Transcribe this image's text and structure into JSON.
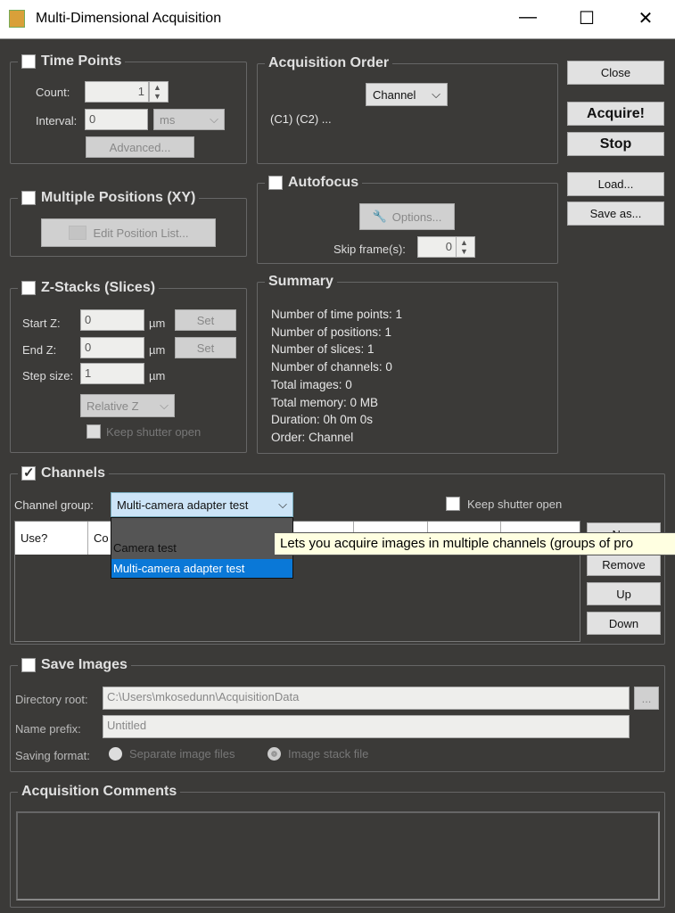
{
  "window": {
    "title": "Multi-Dimensional Acquisition",
    "minimize": "—",
    "maximize": "☐",
    "close": "✕"
  },
  "time_points": {
    "title": "Time Points",
    "checked": false,
    "count_label": "Count:",
    "count": "1",
    "interval_label": "Interval:",
    "interval": "0",
    "unit": "ms",
    "advanced": "Advanced..."
  },
  "positions": {
    "title": "Multiple Positions (XY)",
    "checked": false,
    "edit": "Edit Position List..."
  },
  "zstack": {
    "title": "Z-Stacks (Slices)",
    "checked": false,
    "start_label": "Start Z:",
    "start": "0",
    "end_label": "End Z:",
    "end": "0",
    "step_label": "Step size:",
    "step": "1",
    "unit": "µm",
    "set": "Set",
    "mode": "Relative Z",
    "keep_shutter": "Keep shutter open"
  },
  "order": {
    "title": "Acquisition Order",
    "mode": "Channel",
    "text": "(C1) (C2) ..."
  },
  "autofocus": {
    "title": "Autofocus",
    "checked": false,
    "options": "Options...",
    "skip_label": "Skip frame(s):",
    "skip": "0"
  },
  "summary": {
    "title": "Summary",
    "lines": [
      "Number of time points: 1",
      "Number of positions: 1",
      "Number of slices: 1",
      "Number of channels: 0",
      "Total images: 0",
      "Total memory: 0 MB",
      "Duration: 0h 0m 0s",
      "Order: Channel"
    ]
  },
  "buttons": {
    "close": "Close",
    "acquire": "Acquire!",
    "stop": "Stop",
    "load": "Load...",
    "save_as": "Save as..."
  },
  "channels": {
    "title": "Channels",
    "checked": true,
    "group_label": "Channel group:",
    "group": "Multi-camera adapter test",
    "keep_shutter": "Keep shutter open",
    "columns": [
      "Use?",
      "Co"
    ],
    "options": [
      "Camera test",
      "Multi-camera adapter test"
    ],
    "new": "New",
    "remove": "Remove",
    "up": "Up",
    "down": "Down",
    "tooltip": "Lets you acquire images in multiple channels (groups of pro"
  },
  "save": {
    "title": "Save Images",
    "checked": false,
    "dir_label": "Directory root:",
    "dir": "C:\\Users\\mkosedunn\\AcquisitionData",
    "browse": "...",
    "prefix_label": "Name prefix:",
    "prefix": "Untitled",
    "format_label": "Saving format:",
    "opt1": "Separate image files",
    "opt2": "Image stack file"
  },
  "comments": {
    "title": "Acquisition Comments",
    "value": ""
  }
}
